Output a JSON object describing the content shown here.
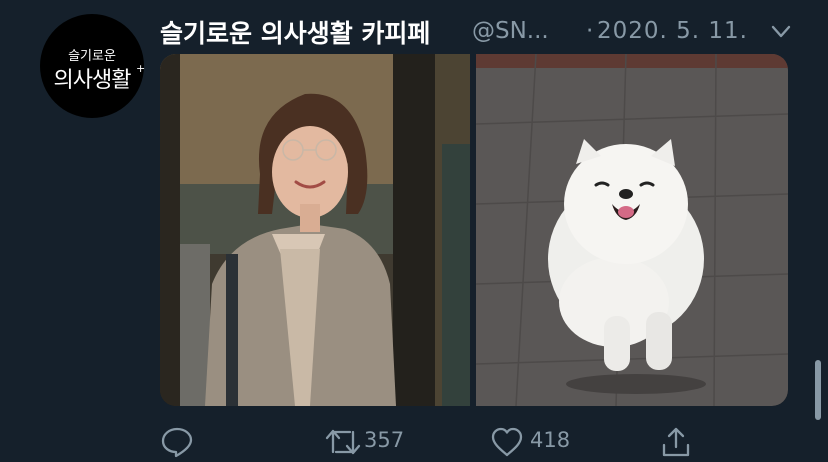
{
  "account": {
    "avatar_line1": "슬기로운",
    "avatar_line2": "의사생활",
    "avatar_plus": "+",
    "display_name": "슬기로운 의사생활 카피페",
    "handle": "@SN...",
    "separator": "·",
    "date": "2020. 5. 11."
  },
  "media": {
    "left_image": "woman-smiling-photo",
    "right_image": "white-pomeranian-photo"
  },
  "actions": {
    "reply_icon": "reply-icon",
    "retweet_icon": "retweet-icon",
    "retweet_count": "357",
    "like_icon": "heart-icon",
    "like_count": "418",
    "share_icon": "share-icon"
  },
  "colors": {
    "background": "#15202b",
    "secondary_text": "#8899a6",
    "primary_text": "#ffffff"
  }
}
